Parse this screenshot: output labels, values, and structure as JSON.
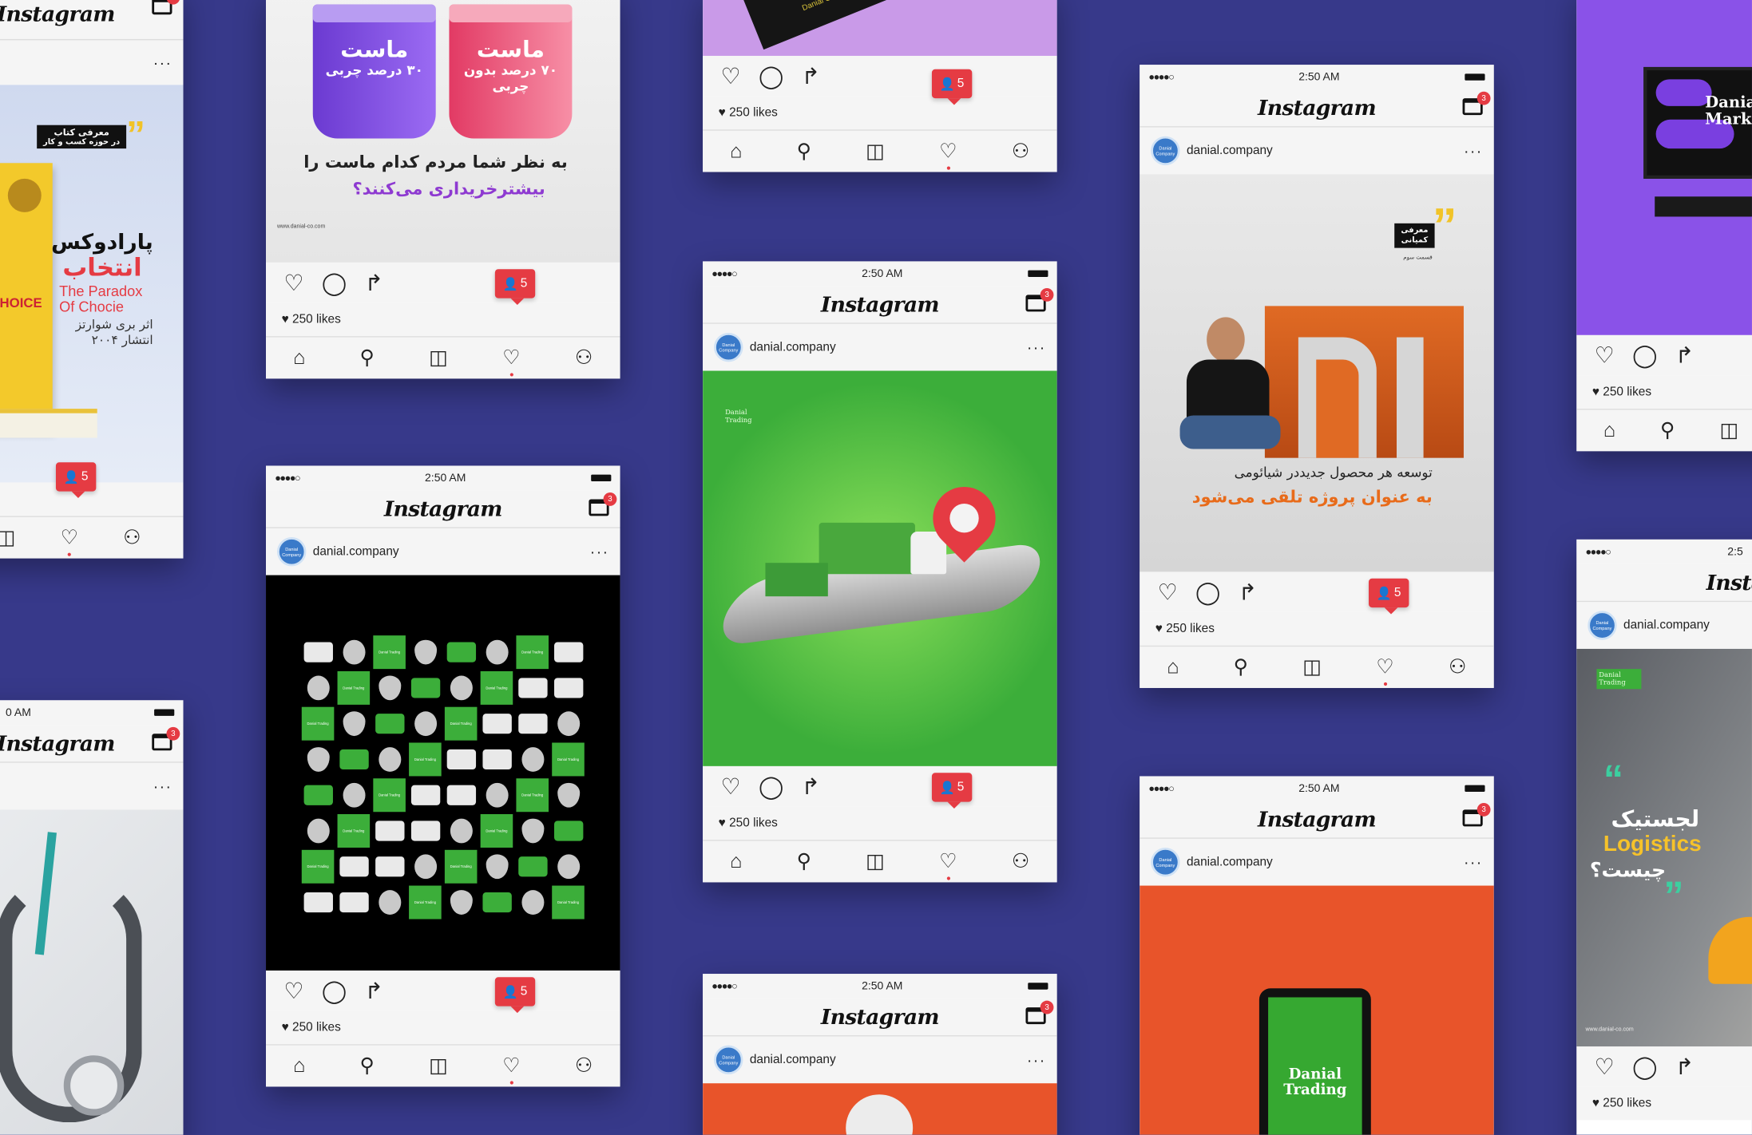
{
  "app": {
    "logo": "Instagram",
    "username": "danial.company",
    "time": "2:50 AM",
    "badge": "3",
    "likes": "250 likes",
    "notif_count": "5",
    "more": "···",
    "signal": "●●●●○",
    "avatar_text": "Danial Company"
  },
  "icons": {
    "heart": "heart-icon",
    "comment": "comment-icon",
    "share": "share-icon",
    "home": "home-icon",
    "search": "search-icon",
    "camera": "camera-icon",
    "profile": "profile-icon",
    "inbox": "inbox-icon"
  },
  "posts": {
    "yogurt": {
      "cup1_title": "ماست",
      "cup1_sub": "۳۰ درصد چربی",
      "cup2_title": "ماست",
      "cup2_sub": "۷۰ درصد بدون چربی",
      "line1": "به نظر شما مردم کدام ماست را",
      "line2": "بیشترخریداری می‌کنند؟",
      "footer": "www.danial-co.com"
    },
    "book": {
      "tag1": "معرفی کتاب",
      "tag2": "در حوزه کسب و کار",
      "title": "پارادوکس",
      "title2": "انتخاب",
      "en1": "The Paradox",
      "en2": "Of Chocie",
      "author": "اثر بری شوارتز",
      "year": "انتشار ۲۰۰۴",
      "cover": "CHOICE"
    },
    "card": {
      "brand": "Danial Coorporation"
    },
    "green": {
      "brand": "Danial Trading"
    },
    "pattern": {
      "tile": "Danial Trading"
    },
    "xiaomi": {
      "tag1": "معرفی",
      "tag2": "کمپانی",
      "tag3": "قسمت سوم",
      "line1": "توسعه هر محصول جدیددر شیائومی",
      "line2": "به عنوان پروژه تلقی می‌شود"
    },
    "marketing": {
      "line1": "Danial",
      "line2": "Marke"
    },
    "orange": {
      "brand": "Danial Trading"
    },
    "logistics": {
      "fa1": "لجستیک",
      "en": "Logistics",
      "fa2": "چیست؟",
      "brand": "Danial Trading",
      "footer": "www.danial-co.com"
    }
  },
  "partial": {
    "logo_left": "gram",
    "time_left": "0 AM",
    "logo_right": "Insta",
    "time_right": "2:5"
  },
  "colors": {
    "background": "#37398a",
    "accent": "#e53b43",
    "green": "#3cae3a",
    "orange": "#e8542a",
    "purple": "#8a52e8"
  }
}
